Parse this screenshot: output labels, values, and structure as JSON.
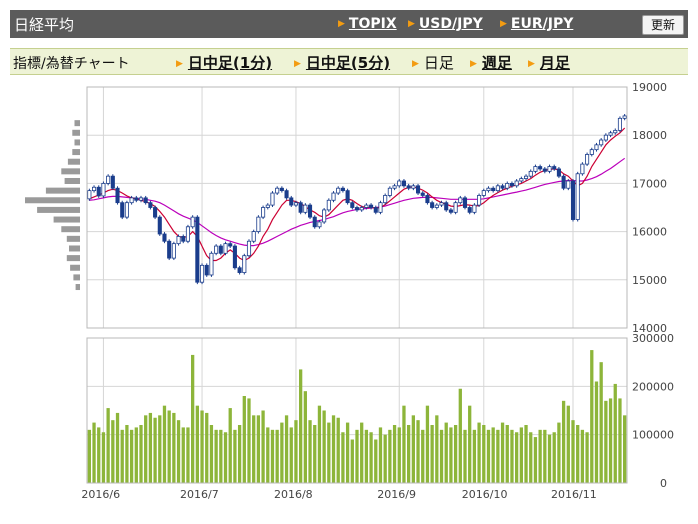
{
  "header": {
    "title": "日経平均",
    "links": [
      "TOPIX",
      "USD/JPY",
      "EUR/JPY"
    ],
    "refresh_label": "更新"
  },
  "tabs": {
    "caption": "指標/為替チャート",
    "items": [
      {
        "label": "日中足(1分)",
        "link": true
      },
      {
        "label": "日中足(5分)",
        "link": true
      },
      {
        "label": "日足",
        "link": false
      },
      {
        "label": "週足",
        "link": true
      },
      {
        "label": "月足",
        "link": true
      }
    ]
  },
  "colors": {
    "up": "#ffffff",
    "down": "#1a3d8c",
    "ma_short": "#cc0033",
    "ma_long": "#bb00bb",
    "volume": "#8db53a",
    "grid": "#d6d6d6",
    "profile": "#9a9a9a"
  },
  "chart_data": [
    {
      "type": "candlestick",
      "title": "",
      "y_ticks": [
        14000,
        15000,
        16000,
        17000,
        18000,
        19000
      ],
      "ylim": [
        14000,
        19000
      ],
      "x_ticks": [
        "2016/6",
        "2016/7",
        "2016/8",
        "2016/9",
        "2016/10",
        "2016/11"
      ],
      "x_tick_index": [
        3,
        24,
        44,
        66,
        84,
        103
      ],
      "candles": [
        [
          16680,
          16850
        ],
        [
          16850,
          16920
        ],
        [
          16920,
          16740
        ],
        [
          16740,
          17000
        ],
        [
          17000,
          17150
        ],
        [
          17150,
          16900
        ],
        [
          16900,
          16600
        ],
        [
          16600,
          16300
        ],
        [
          16300,
          16600
        ],
        [
          16600,
          16700
        ],
        [
          16700,
          16650
        ],
        [
          16650,
          16700
        ],
        [
          16700,
          16600
        ],
        [
          16600,
          16500
        ],
        [
          16500,
          16300
        ],
        [
          16300,
          15950
        ],
        [
          15950,
          15800
        ],
        [
          15800,
          15450
        ],
        [
          15450,
          15750
        ],
        [
          15750,
          15900
        ],
        [
          15900,
          15800
        ],
        [
          15800,
          16100
        ],
        [
          16100,
          16300
        ],
        [
          16300,
          14950
        ],
        [
          14950,
          15300
        ],
        [
          15300,
          15100
        ],
        [
          15100,
          15550
        ],
        [
          15550,
          15700
        ],
        [
          15700,
          15550
        ],
        [
          15550,
          15750
        ],
        [
          15750,
          15700
        ],
        [
          15700,
          15250
        ],
        [
          15250,
          15150
        ],
        [
          15150,
          15500
        ],
        [
          15500,
          15800
        ],
        [
          15800,
          16000
        ],
        [
          16000,
          16300
        ],
        [
          16300,
          16500
        ],
        [
          16500,
          16550
        ],
        [
          16550,
          16800
        ],
        [
          16800,
          16900
        ],
        [
          16900,
          16850
        ],
        [
          16850,
          16700
        ],
        [
          16700,
          16550
        ],
        [
          16550,
          16600
        ],
        [
          16600,
          16400
        ],
        [
          16400,
          16550
        ],
        [
          16550,
          16300
        ],
        [
          16300,
          16100
        ],
        [
          16100,
          16200
        ],
        [
          16200,
          16450
        ],
        [
          16450,
          16650
        ],
        [
          16650,
          16800
        ],
        [
          16800,
          16900
        ],
        [
          16900,
          16850
        ],
        [
          16850,
          16600
        ],
        [
          16600,
          16500
        ],
        [
          16500,
          16450
        ],
        [
          16450,
          16500
        ],
        [
          16500,
          16550
        ],
        [
          16550,
          16500
        ],
        [
          16500,
          16400
        ],
        [
          16400,
          16600
        ],
        [
          16600,
          16750
        ],
        [
          16750,
          16900
        ],
        [
          16900,
          16950
        ],
        [
          16950,
          17050
        ],
        [
          17050,
          16950
        ],
        [
          16950,
          16900
        ],
        [
          16900,
          16950
        ],
        [
          16950,
          16800
        ],
        [
          16800,
          16750
        ],
        [
          16750,
          16600
        ],
        [
          16600,
          16500
        ],
        [
          16500,
          16550
        ],
        [
          16550,
          16600
        ],
        [
          16600,
          16450
        ],
        [
          16450,
          16400
        ],
        [
          16400,
          16600
        ],
        [
          16600,
          16700
        ],
        [
          16700,
          16500
        ],
        [
          16500,
          16400
        ],
        [
          16400,
          16550
        ],
        [
          16550,
          16750
        ],
        [
          16750,
          16850
        ],
        [
          16850,
          16900
        ],
        [
          16900,
          16850
        ],
        [
          16850,
          16950
        ],
        [
          16950,
          16900
        ],
        [
          16900,
          17000
        ],
        [
          17000,
          16950
        ],
        [
          16950,
          17050
        ],
        [
          17050,
          17100
        ],
        [
          17100,
          17150
        ],
        [
          17150,
          17250
        ],
        [
          17250,
          17350
        ],
        [
          17350,
          17300
        ],
        [
          17300,
          17250
        ],
        [
          17250,
          17350
        ],
        [
          17350,
          17300
        ],
        [
          17300,
          17150
        ],
        [
          17150,
          16900
        ],
        [
          16900,
          17050
        ],
        [
          17050,
          16250
        ],
        [
          16250,
          17200
        ],
        [
          17200,
          17400
        ],
        [
          17400,
          17600
        ],
        [
          17600,
          17700
        ],
        [
          17700,
          17800
        ],
        [
          17800,
          17900
        ],
        [
          17900,
          18000
        ],
        [
          18000,
          18050
        ],
        [
          18050,
          18100
        ],
        [
          18100,
          18350
        ],
        [
          18350,
          18400
        ]
      ],
      "ma_short": [
        16680,
        16720,
        16760,
        16800,
        16850,
        16880,
        16850,
        16800,
        16740,
        16700,
        16680,
        16650,
        16620,
        16580,
        16520,
        16420,
        16300,
        16150,
        16000,
        15900,
        15880,
        15900,
        16000,
        15900,
        15700,
        15500,
        15400,
        15400,
        15450,
        15550,
        15620,
        15550,
        15450,
        15400,
        15450,
        15550,
        15700,
        15900,
        16050,
        16250,
        16400,
        16550,
        16650,
        16650,
        16620,
        16580,
        16520,
        16450,
        16400,
        16330,
        16300,
        16350,
        16450,
        16550,
        16650,
        16680,
        16650,
        16580,
        16520,
        16500,
        16500,
        16490,
        16500,
        16560,
        16640,
        16720,
        16800,
        16880,
        16920,
        16930,
        16900,
        16860,
        16800,
        16720,
        16650,
        16600,
        16570,
        16530,
        16520,
        16540,
        16560,
        16550,
        16530,
        16540,
        16600,
        16680,
        16750,
        16810,
        16860,
        16900,
        16940,
        16970,
        17000,
        17050,
        17100,
        17170,
        17230,
        17270,
        17290,
        17300,
        17280,
        17200,
        17150,
        17050,
        16950,
        17000,
        17150,
        17350,
        17500,
        17650,
        17800,
        17900,
        17980,
        18050,
        18150
      ],
      "ma_long": [
        16650,
        16660,
        16680,
        16700,
        16720,
        16730,
        16730,
        16720,
        16710,
        16700,
        16690,
        16680,
        16670,
        16650,
        16630,
        16600,
        16550,
        16490,
        16430,
        16370,
        16320,
        16280,
        16240,
        16190,
        16120,
        16050,
        15980,
        15920,
        15870,
        15830,
        15800,
        15770,
        15740,
        15720,
        15710,
        15710,
        15730,
        15760,
        15800,
        15850,
        15900,
        15950,
        16000,
        16050,
        16090,
        16130,
        16160,
        16190,
        16210,
        16230,
        16250,
        16280,
        16310,
        16350,
        16390,
        16420,
        16440,
        16460,
        16470,
        16480,
        16490,
        16500,
        16510,
        16530,
        16560,
        16590,
        16620,
        16650,
        16670,
        16690,
        16700,
        16710,
        16710,
        16710,
        16700,
        16690,
        16680,
        16670,
        16670,
        16670,
        16670,
        16670,
        16670,
        16670,
        16680,
        16700,
        16720,
        16740,
        16760,
        16780,
        16800,
        16820,
        16840,
        16860,
        16890,
        16920,
        16950,
        16980,
        17000,
        17020,
        17040,
        17050,
        17060,
        17060,
        17050,
        17050,
        17070,
        17100,
        17140,
        17190,
        17250,
        17310,
        17380,
        17450,
        17520
      ]
    },
    {
      "type": "bar",
      "title": "",
      "y_ticks": [
        0,
        100000,
        200000,
        300000
      ],
      "ylim": [
        0,
        300000
      ],
      "volumes": [
        110000,
        125000,
        115000,
        105000,
        155000,
        130000,
        145000,
        110000,
        120000,
        110000,
        115000,
        120000,
        140000,
        145000,
        135000,
        140000,
        160000,
        150000,
        145000,
        130000,
        115000,
        115000,
        265000,
        160000,
        150000,
        145000,
        120000,
        110000,
        110000,
        105000,
        155000,
        110000,
        120000,
        180000,
        175000,
        140000,
        140000,
        150000,
        115000,
        110000,
        110000,
        125000,
        140000,
        115000,
        130000,
        235000,
        190000,
        130000,
        120000,
        160000,
        150000,
        125000,
        140000,
        135000,
        105000,
        125000,
        90000,
        110000,
        125000,
        110000,
        105000,
        90000,
        115000,
        100000,
        110000,
        120000,
        115000,
        160000,
        120000,
        140000,
        130000,
        110000,
        160000,
        120000,
        140000,
        110000,
        125000,
        115000,
        120000,
        195000,
        110000,
        160000,
        110000,
        125000,
        120000,
        110000,
        115000,
        110000,
        125000,
        120000,
        110000,
        105000,
        115000,
        120000,
        105000,
        95000,
        110000,
        110000,
        100000,
        105000,
        125000,
        170000,
        160000,
        130000,
        120000,
        110000,
        105000,
        275000,
        210000,
        250000,
        170000,
        175000,
        205000,
        175000,
        140000
      ]
    },
    {
      "type": "bar",
      "title": "",
      "orientation": "horizontal",
      "price_levels": [
        18250,
        18050,
        17850,
        17650,
        17450,
        17250,
        17050,
        16850,
        16650,
        16450,
        16250,
        16050,
        15850,
        15650,
        15450,
        15250,
        15050,
        14850
      ],
      "volume_share": [
        0.1,
        0.14,
        0.1,
        0.14,
        0.22,
        0.34,
        0.28,
        0.62,
        1.0,
        0.78,
        0.48,
        0.34,
        0.24,
        0.2,
        0.24,
        0.18,
        0.12,
        0.08
      ]
    }
  ]
}
